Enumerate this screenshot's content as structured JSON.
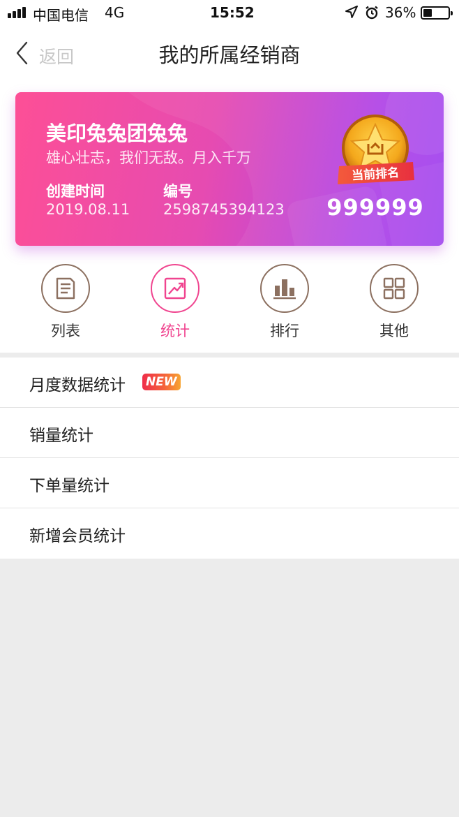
{
  "status_bar": {
    "carrier": "中国电信",
    "network": "4G",
    "time": "15:52",
    "battery_percent": "36%",
    "battery_level": 0.36
  },
  "nav": {
    "back_label": "返回",
    "title": "我的所属经销商"
  },
  "card": {
    "name": "美印兔兔团兔兔",
    "slogan": "雄心壮志，我们无敌。月入千万",
    "created_label": "创建时间",
    "created_value": "2019.08.11",
    "number_label": "编号",
    "number_value": "2598745394123",
    "rank_label": "当前排名",
    "rank_value": "999999"
  },
  "menu": [
    {
      "label": "列表",
      "icon": "document-icon",
      "active": false
    },
    {
      "label": "统计",
      "icon": "trend-chart-icon",
      "active": true
    },
    {
      "label": "排行",
      "icon": "bar-chart-icon",
      "active": false
    },
    {
      "label": "其他",
      "icon": "grid-icon",
      "active": false
    }
  ],
  "list": [
    {
      "label": "月度数据统计",
      "badge": "NEW"
    },
    {
      "label": "销量统计"
    },
    {
      "label": "下单量统计"
    },
    {
      "label": "新增会员统计"
    }
  ],
  "colors": {
    "accent": "#f0448f",
    "card_gradient_start": "#fd4f96",
    "card_gradient_end": "#a044ef",
    "icon_border": "#8c7060"
  }
}
